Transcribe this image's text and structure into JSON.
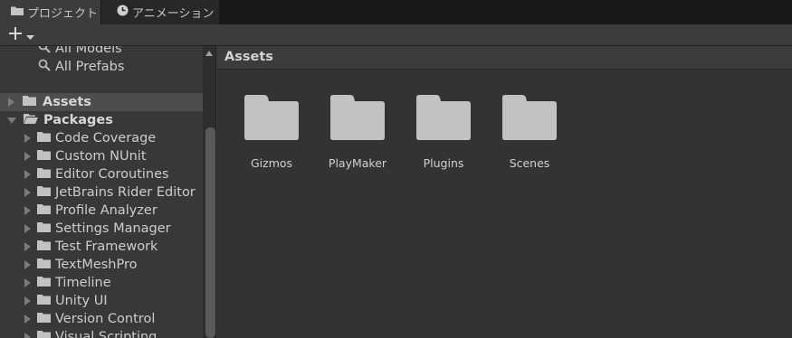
{
  "tabs": [
    {
      "label": "プロジェクト",
      "icon": "folder-icon",
      "active": true
    },
    {
      "label": "アニメーション",
      "icon": "clock-icon",
      "active": false
    }
  ],
  "toolbar": {
    "create_icon": "plus-icon"
  },
  "tree": {
    "favorites": [
      {
        "label": "All Models",
        "icon": "search-icon"
      },
      {
        "label": "All Prefabs",
        "icon": "search-icon"
      }
    ],
    "assets_label": "Assets",
    "packages_label": "Packages",
    "packages": [
      "Code Coverage",
      "Custom NUnit",
      "Editor Coroutines",
      "JetBrains Rider Editor",
      "Profile Analyzer",
      "Settings Manager",
      "Test Framework",
      "TextMeshPro",
      "Timeline",
      "Unity UI",
      "Version Control",
      "Visual Scripting"
    ]
  },
  "breadcrumb": "Assets",
  "assets": [
    "Gizmos",
    "PlayMaker",
    "Plugins",
    "Scenes"
  ],
  "colors": {
    "background": "#383838",
    "content": "#333333",
    "folder": "#c2c2c2",
    "tabbar": "#191919"
  }
}
